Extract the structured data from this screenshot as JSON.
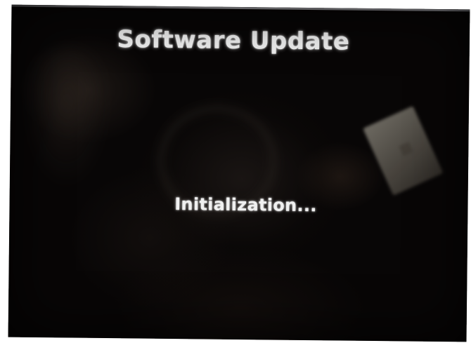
{
  "screen": {
    "title": "Software Update",
    "status": "Initialization..."
  },
  "colors": {
    "background": "#080606",
    "text": "#f2f2f2"
  }
}
